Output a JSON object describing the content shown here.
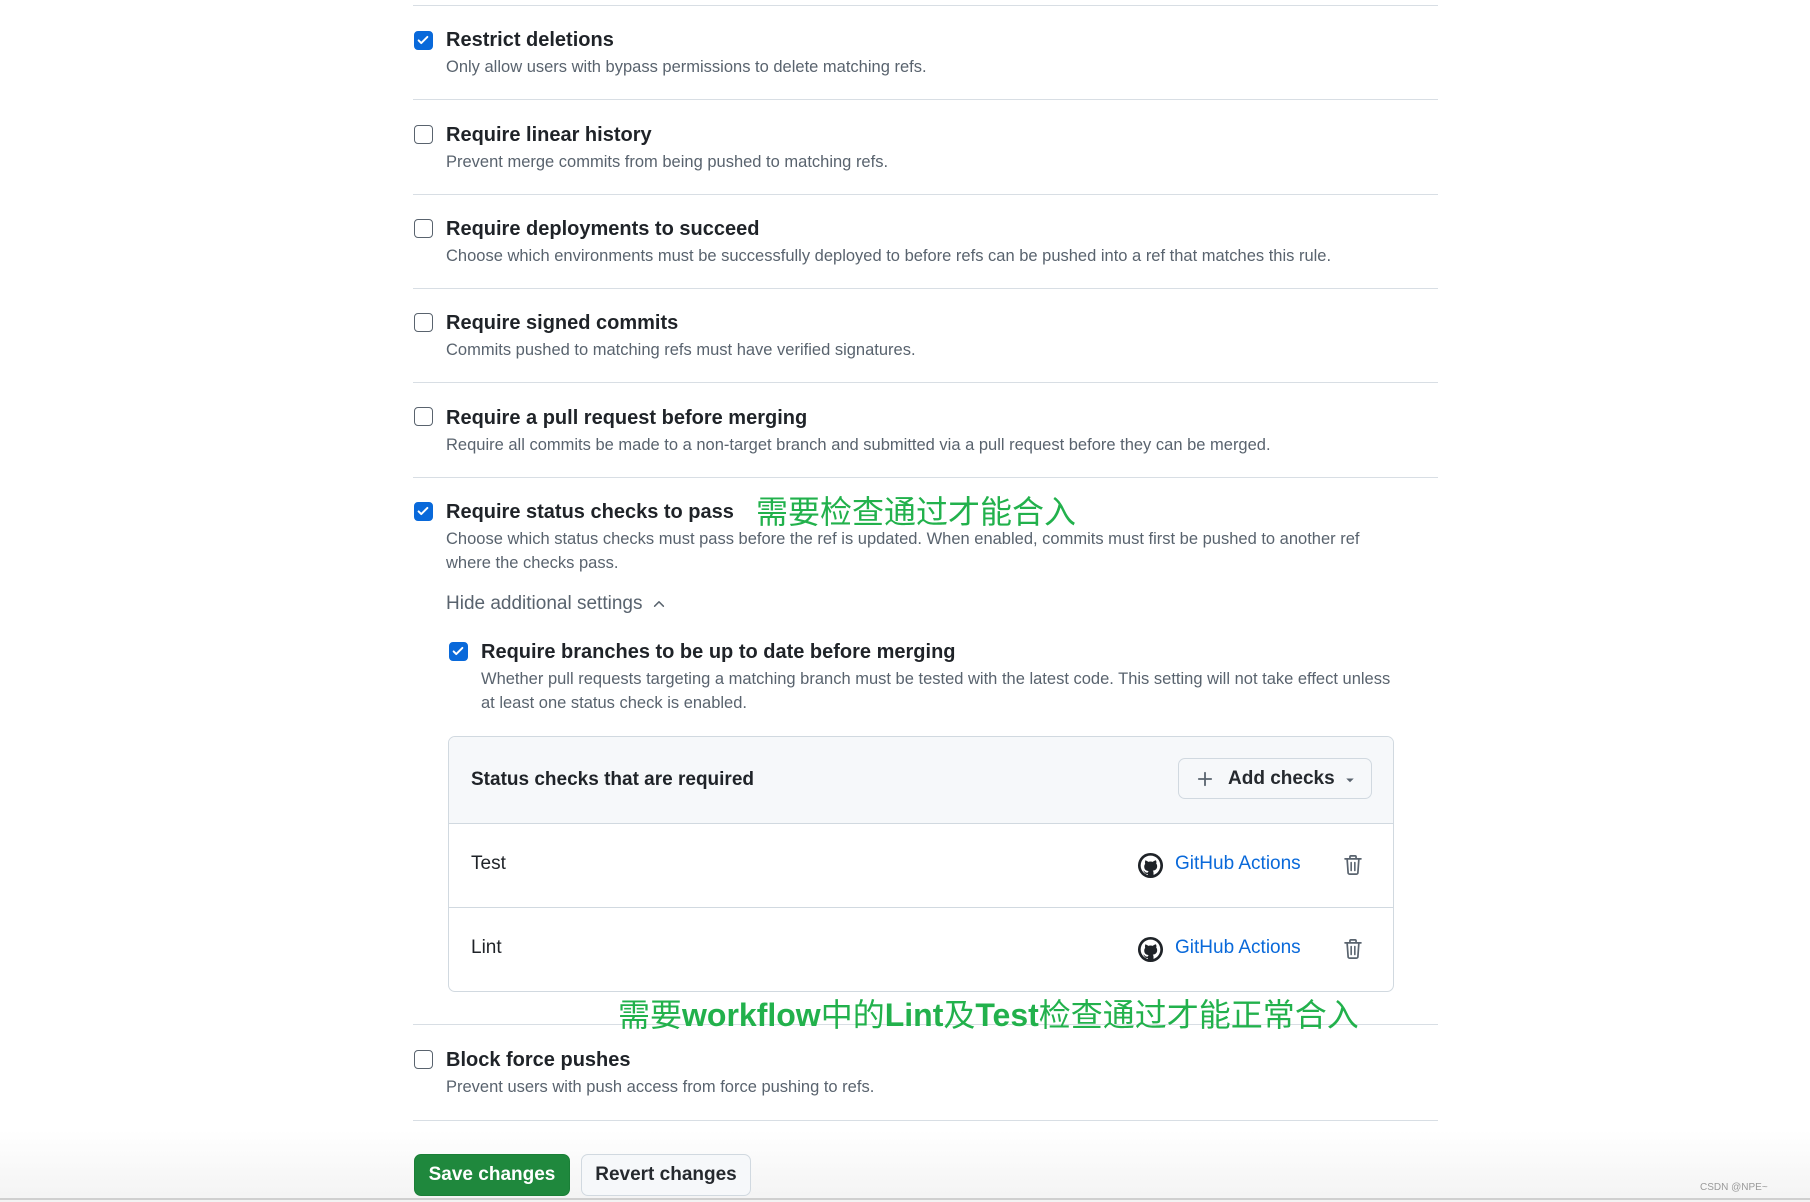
{
  "rules": [
    {
      "title": "Restrict deletions",
      "description": "Only allow users with bypass permissions to delete matching refs.",
      "checked": true
    },
    {
      "title": "Require linear history",
      "description": "Prevent merge commits from being pushed to matching refs.",
      "checked": false
    },
    {
      "title": "Require deployments to succeed",
      "description": "Choose which environments must be successfully deployed to before refs can be pushed into a ref that matches this rule.",
      "checked": false
    },
    {
      "title": "Require signed commits",
      "description": "Commits pushed to matching refs must have verified signatures.",
      "checked": false
    },
    {
      "title": "Require a pull request before merging",
      "description": "Require all commits be made to a non-target branch and submitted via a pull request before they can be merged.",
      "checked": false
    },
    {
      "title": "Require status checks to pass",
      "description": "Choose which status checks must pass before the ref is updated. When enabled, commits must first be pushed to another ref where the checks pass.",
      "checked": true
    },
    {
      "title": "Block force pushes",
      "description": "Prevent users with push access from force pushing to refs.",
      "checked": false
    }
  ],
  "additional_settings": {
    "toggle_label": "Hide additional settings",
    "sub_rule": {
      "title": "Require branches to be up to date before merging",
      "description": "Whether pull requests targeting a matching branch must be tested with the latest code. This setting will not take effect unless at least one status check is enabled.",
      "checked": true
    }
  },
  "status_checks": {
    "header": "Status checks that are required",
    "add_button_label": "Add checks",
    "items": [
      {
        "name": "Test",
        "source": "GitHub Actions"
      },
      {
        "name": "Lint",
        "source": "GitHub Actions"
      }
    ]
  },
  "annotations": {
    "status_checks_note": "需要检查通过才能合入",
    "workflow_note_prefix": "需要",
    "workflow_note_bold1": "workflow",
    "workflow_note_mid1": "中的",
    "workflow_note_bold2": "Lint",
    "workflow_note_mid2": "及",
    "workflow_note_bold3": "Test",
    "workflow_note_suffix": "检查通过才能正常合入"
  },
  "actions": {
    "save_label": "Save changes",
    "revert_label": "Revert changes"
  },
  "watermark": "CSDN @NPE~",
  "colors": {
    "accent": "#0969da",
    "primary_button": "#1f883d",
    "annotation": "#22b14c"
  },
  "icons": {
    "checkbox": "check-icon",
    "toggle": "chevron-up-icon",
    "add": "plus-icon",
    "dropdown": "triangle-down-icon",
    "source": "github-logo-icon",
    "remove": "trash-icon"
  }
}
